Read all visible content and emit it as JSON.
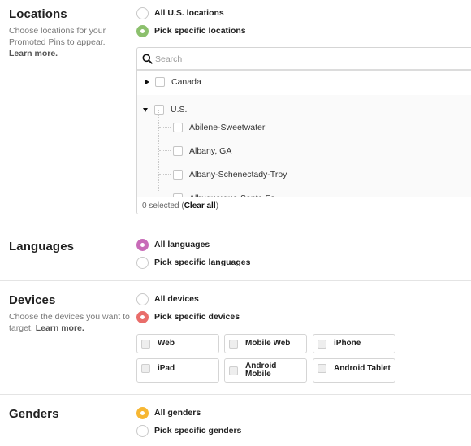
{
  "colors": {
    "locations_accent": "#8cc06d",
    "languages_accent": "#c86bb8",
    "devices_accent": "#e96d6a",
    "genders_accent": "#f7b733"
  },
  "locations": {
    "title": "Locations",
    "description": "Choose locations for your Promoted Pins to appear.",
    "learn_more": "Learn more.",
    "options": [
      {
        "label": "All U.S. locations",
        "selected": false
      },
      {
        "label": "Pick specific locations",
        "selected": true
      }
    ],
    "search": {
      "placeholder": "Search",
      "value": "",
      "icon": "search-icon"
    },
    "tree": [
      {
        "label": "Canada",
        "expanded": false,
        "checked": false,
        "icon": "triangle-right-icon"
      },
      {
        "label": "U.S.",
        "expanded": true,
        "checked": false,
        "icon": "triangle-down-icon",
        "children": [
          {
            "label": "Abilene-Sweetwater",
            "checked": false
          },
          {
            "label": "Albany, GA",
            "checked": false
          },
          {
            "label": "Albany-Schenectady-Troy",
            "checked": false
          },
          {
            "label": "Albuquerque-Santa Fe",
            "checked": false
          }
        ]
      }
    ],
    "footer": {
      "selected_text": "0 selected (",
      "clear_all": "Clear all",
      "close_paren": ")"
    }
  },
  "languages": {
    "title": "Languages",
    "options": [
      {
        "label": "All languages",
        "selected": true
      },
      {
        "label": "Pick specific languages",
        "selected": false
      }
    ]
  },
  "devices": {
    "title": "Devices",
    "description": "Choose the devices you want to target.",
    "learn_more": "Learn more.",
    "options": [
      {
        "label": "All devices",
        "selected": false
      },
      {
        "label": "Pick specific devices",
        "selected": true
      }
    ],
    "device_list": [
      {
        "label": "Web",
        "checked": false
      },
      {
        "label": "Mobile Web",
        "checked": false
      },
      {
        "label": "iPhone",
        "checked": false
      },
      {
        "label": "iPad",
        "checked": false
      },
      {
        "label": "Android Mobile",
        "checked": false
      },
      {
        "label": "Android Tablet",
        "checked": false
      }
    ]
  },
  "genders": {
    "title": "Genders",
    "options": [
      {
        "label": "All genders",
        "selected": true
      },
      {
        "label": "Pick specific genders",
        "selected": false
      }
    ]
  }
}
